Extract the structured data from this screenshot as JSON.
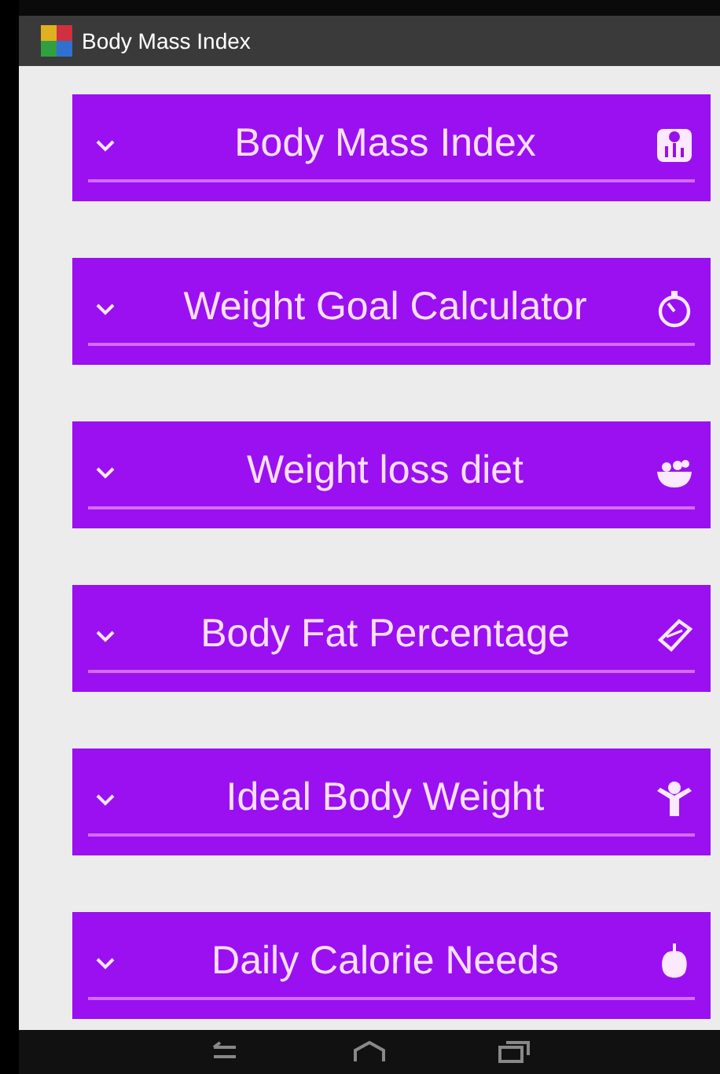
{
  "app_bar": {
    "title": "Body Mass Index"
  },
  "sections": [
    {
      "title": "Body Mass Index",
      "expanded": false
    },
    {
      "title": "Weight Goal Calculator",
      "expanded": false
    },
    {
      "title": "Weight loss diet",
      "expanded": false
    },
    {
      "title": "Body Fat Percentage",
      "expanded": false
    },
    {
      "title": "Ideal Body Weight",
      "expanded": false
    },
    {
      "title": "Daily Calorie Needs",
      "expanded": false
    }
  ]
}
